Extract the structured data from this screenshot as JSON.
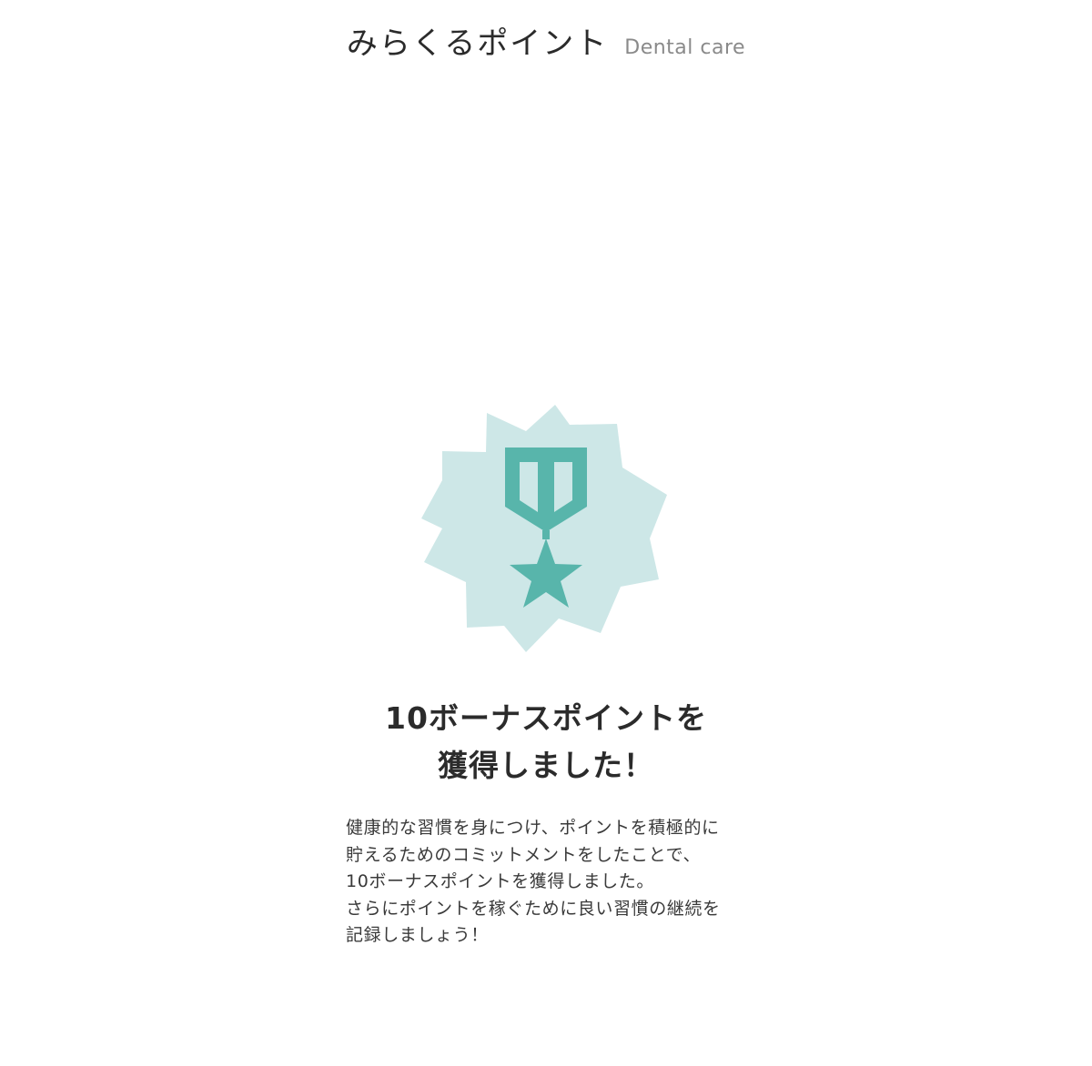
{
  "header": {
    "title": "みらくるポイント",
    "subtitle": "Dental care"
  },
  "badge": {
    "icon": "medal-icon",
    "colors": {
      "burst": "#cde7e7",
      "medal": "#58b5ab"
    }
  },
  "headline": {
    "line1": "10ボーナスポイントを",
    "line2": "獲得しました！"
  },
  "message": {
    "lines": [
      "健康的な習慣を身につけ、ポイントを積極的に",
      "貯えるためのコミットメントをしたことで、",
      "10ボーナスポイントを獲得しました。",
      "さらにポイントを稼ぐために良い習慣の継続を",
      "記録しましょう！"
    ]
  }
}
